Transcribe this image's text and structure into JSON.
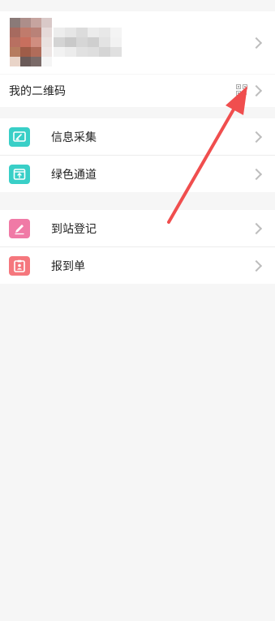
{
  "profile": {
    "avatar_cells": [
      "#8a7a78",
      "#ad8e8a",
      "#c6a49f",
      "#d9c9c8",
      "#a66a5f",
      "#c07b6c",
      "#b98278",
      "#e5d9d8",
      "#b87061",
      "#c86f5e",
      "#d08e80",
      "#e9e1df",
      "#b67c5f",
      "#9e5c48",
      "#b06c5a",
      "#ede6e5",
      "#e9d4c8",
      "#6a5a58",
      "#7a6a68",
      "#f5f5f5"
    ],
    "name_cells": [
      "#ededed",
      "#e6e6e6",
      "#dcdcdc",
      "#ececec",
      "#e8e8e8",
      "#f4f4f4",
      "#d4d4d4",
      "#c9c9c9",
      "#d6d6d6",
      "#cfcfcf",
      "#e3e3e3",
      "#f2f2f2",
      "#f2f2f2",
      "#ececec",
      "#e1e1e1",
      "#dedede",
      "#d5d5d5",
      "#e0e0e0"
    ]
  },
  "qr_row": {
    "label": "我的二维码",
    "icon": "qr-code-icon"
  },
  "menu_group_1": [
    {
      "label": "信息采集",
      "icon": "edit-card-icon",
      "color": "#39cfc7"
    },
    {
      "label": "绿色通道",
      "icon": "upload-box-icon",
      "color": "#39cfc7"
    }
  ],
  "menu_group_2": [
    {
      "label": "到站登记",
      "icon": "pencil-icon",
      "color": "#f07aa6"
    },
    {
      "label": "报到单",
      "icon": "clipboard-user-icon",
      "color": "#f5777d"
    }
  ],
  "annotation": {
    "color": "#f04e4e"
  }
}
